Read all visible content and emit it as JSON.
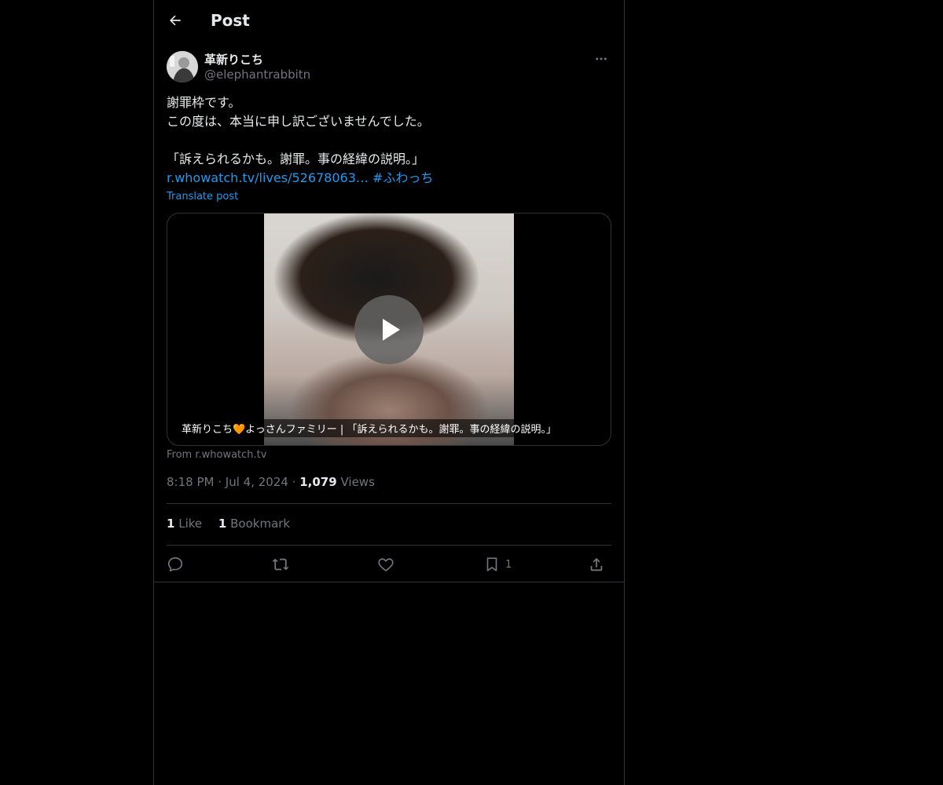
{
  "header": {
    "title": "Post"
  },
  "author": {
    "name": "革新りこち",
    "handle": "@elephantrabbitn"
  },
  "post": {
    "lines": [
      "謝罪枠です。",
      "この度は、本当に申し訳ございませんでした。",
      "",
      "「訴えられるかも。謝罪。事の経緯の説明。」"
    ],
    "link_text": "r.whowatch.tv/lives/52678063…",
    "hashtag": "#ふわっち",
    "translate_label": "Translate post"
  },
  "card": {
    "caption": "革新りこち🧡よっさんファミリー | 「訴えられるかも。謝罪。事の経緯の説明。」",
    "source": "From r.whowatch.tv"
  },
  "meta": {
    "time": "8:18 PM",
    "date": "Jul 4, 2024",
    "views_count": "1,079",
    "views_label": "Views"
  },
  "stats": {
    "likes_count": "1",
    "likes_label": "Like",
    "bookmarks_count": "1",
    "bookmarks_label": "Bookmark"
  },
  "actions": {
    "bookmark_count": "1"
  },
  "colors": {
    "background": "#000000",
    "text": "#e7e9ea",
    "muted": "#71767b",
    "link": "#1d9bf0",
    "border": "#2f3336"
  }
}
